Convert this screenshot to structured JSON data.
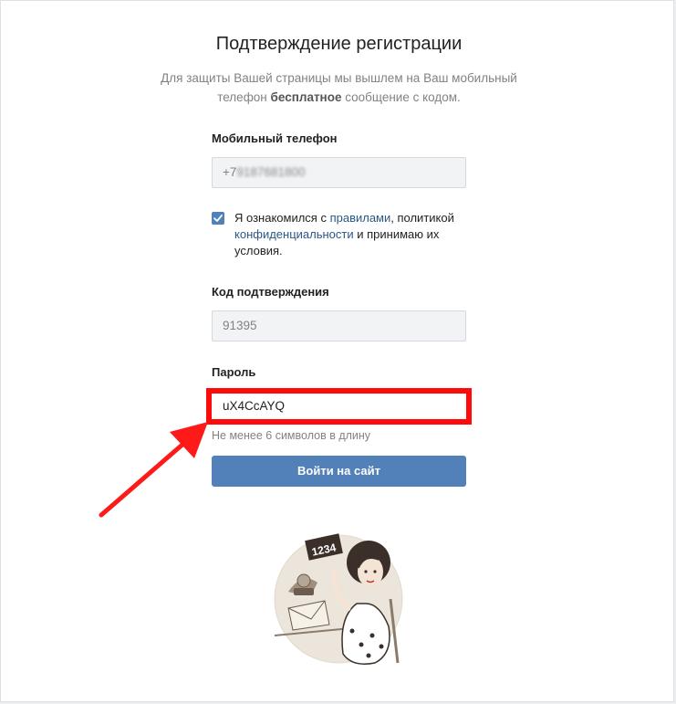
{
  "page": {
    "title": "Подтверждение регистрации",
    "subtitle_part1": "Для защиты Вашей страницы мы вышлем на Ваш мобильный телефон ",
    "subtitle_bold": "бесплатное",
    "subtitle_part2": " сообщение с кодом."
  },
  "phone": {
    "label": "Мобильный телефон",
    "prefix": "+7",
    "value_blurred": "9187681800"
  },
  "agreement": {
    "checked": true,
    "text1": "Я ознакомился с ",
    "link_rules": "правилами",
    "text2": ", политикой ",
    "link_privacy": "конфиденциальности",
    "text3": " и принимаю их условия."
  },
  "code": {
    "label": "Код подтверждения",
    "value": "91395"
  },
  "password": {
    "label": "Пароль",
    "value": "uX4CcAYQ",
    "hint": "Не менее 6 символов в длину"
  },
  "submit": {
    "label": "Войти на сайт"
  },
  "illustration": {
    "card_text": "1234"
  },
  "colors": {
    "accent": "#5181b8",
    "link": "#2a5885",
    "highlight": "#ff0a0a",
    "field_bg": "#f2f3f5"
  }
}
